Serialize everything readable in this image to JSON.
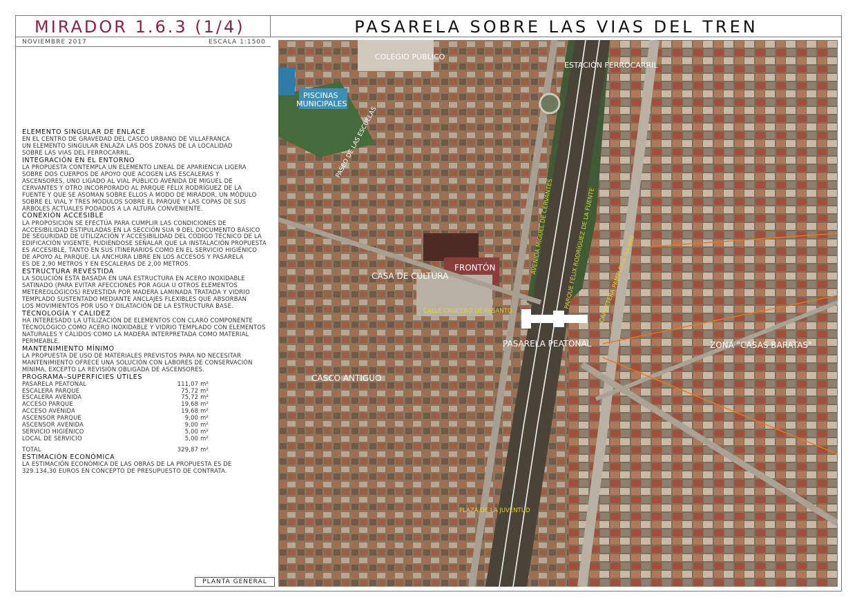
{
  "header": {
    "left_title": "MIRADOR 1.6.3 (1/4)",
    "right_title": "PASARELA SOBRE LAS VIAS DEL TREN",
    "date": "NOVIEMBRE 2017",
    "scale": "ESCALA 1:1500"
  },
  "colors": {
    "title_accent": "#8a2341",
    "map_labels": "#ffffff",
    "street_labels": "#e3d23a",
    "paths": "#e8781e"
  },
  "sections": [
    {
      "heading": "ELEMENTO SINGULAR DE ENLACE",
      "lines": [
        "EN EL CENTRO DE GRAVEDAD DEL CASCO URBANO DE VILLAFRANCA",
        "UN ELEMENTO SINGULAR ENLAZA LAS DOS ZONAS DE LA LOCALIDAD",
        "SOBRE LAS VIAS DEL FERROCARRIL."
      ]
    },
    {
      "heading": "INTEGRACIÓN EN EL ENTORNO",
      "lines": [
        "LA PROPUESTA CONTEMPLA UN ELEMENTO LINEAL DE APARIENCIA LIGERA",
        "SOBRE DOS CUERPOS DE APOYO QUE ACOGEN LAS ESCALERAS Y",
        "ASCENSORES, UNO LIGADO AL VIAL PÚBLICO AVENIDA DE MIGUEL DE",
        "CERVANTES Y OTRO INCORPORADO AL PARQUE FÉLIX RODRÍGUEZ DE LA",
        "FUENTE Y QUE SE ASOMAN SOBRE ELLOS A MODO DE MIRADOR, UN MÓDULO",
        "SOBRE EL VIAL Y TRES MÓDULOS SOBRE EL PARQUE Y LAS COPAS DE SUS",
        "ÁRBOLES ACTUALES PODADOS A LA ALTURA CONVENIENTE."
      ]
    },
    {
      "heading": "CONEXIÓN ACCESIBLE",
      "lines": [
        "LA PROPOSICIÓN SE EFECTÚA PARA CUMPLIR LAS CONDICIONES DE",
        "ACCESIBILIDAD ESTIPULADAS EN LA SECCIÓN SUA 9 DEL DOCUMENTO BÁSICO",
        "DE SEGURIDAD DE UTILIZACIÓN Y ACCESIBILIDAD DEL CÓDIGO TÉCNICO DE LA",
        "EDIFICACIÓN VIGENTE, PUDIÉNDOSE SEÑALAR QUE LA INSTALACIÓN PROPUESTA",
        "ES ACCESIBLE, TANTO EN SUS ITINERARIOS COMO EN EL SERVICIO HIGIÉNICO",
        "DE APOYO AL PARQUE. LA ANCHURA LIBRE EN LOS ACCESOS Y PASARELA",
        "ES DE 2,90 METROS Y EN ESCALERAS DE 2,00 METROS."
      ]
    },
    {
      "heading": "ESTRUCTURA REVESTIDA",
      "lines": [
        "LA SOLUCIÓN ESTA BASADA EN UNA ESTRUCTURA EN ACERO INOXIDABLE",
        "SATINADO (PARA EVITAR AFECCIONES POR AGUA U OTROS ELEMENTOS",
        "METEREOLÓGICOS) REVESTIDA POR MADERA LAMINADA TRATADA Y VIDRIO",
        "TEMPLADO SUSTENTADO MEDIANTE ANCLAJES FLEXIBLES QUE ABSORBAN",
        "LOS MOVIMIENTOS POR USO Y DILATACIÓN DE LA ESTRUCTURA BASE."
      ]
    },
    {
      "heading": "TECNOLOGÍA Y CALIDEZ",
      "lines": [
        "HA INTERESADO LA UTILIZACIÓN DE ELEMENTOS CON CLARO COMPONENTE",
        "TECNOLÓGICO COMO ACERO INOXIDABLE Y VIDRIO TEMPLADO CON ELEMENTOS",
        "NATURALES Y CÁLIDOS COMO LA MADERA INTERPRETADA COMO MATERIAL",
        "PERMEABLE."
      ]
    },
    {
      "heading": "MANTENIMIENTO MÍNIMO",
      "lines": [
        "LA PROPUESTA DE USO DE MATERIALES PREVISTOS PARA NO NECESITAR",
        "MANTENIMIENTO OFRECE UNA SOLUCIÓN CON LABORES DE CONSERVACIÓN",
        "MÍNIMA, EXCEPTO LA REVISIÓN OBLIGADA DE ASCENSORES."
      ]
    }
  ],
  "program": {
    "heading": "PROGRAMA–SUPERFICIES ÚTILES",
    "rows": [
      {
        "name": "PASARELA PEATONAL",
        "value": "111,07 m²"
      },
      {
        "name": "ESCALERA PARQUE",
        "value": "75,72 m²"
      },
      {
        "name": "ESCALERA AVENIDA",
        "value": "75,72 m²"
      },
      {
        "name": "ACCESO PARQUE",
        "value": "19,68 m²"
      },
      {
        "name": "ACCESO AVENIDA",
        "value": "19,68 m²"
      },
      {
        "name": "ASCENSOR PARQUE",
        "value": "9,00 m²"
      },
      {
        "name": "ASCENSOR AVENIDA",
        "value": "9,00 m²"
      },
      {
        "name": "SERVICIO HIGIÉNICO",
        "value": "5,00 m²"
      },
      {
        "name": "LOCAL DE SERVICIO",
        "value": "5,00 m²"
      }
    ],
    "total_label": "TOTAL",
    "total_value": "329,87 m²"
  },
  "estimate": {
    "heading": "ESTIMACIÓN ECONÓMICA",
    "lines": [
      "LA ESTIMACIÓN ECONÓMICA DE LAS OBRAS DE LA PROPUESTA ES DE",
      "329.134,30 EUROS EN CONCEPTO DE PRESUPUESTO DE CONTRATA."
    ]
  },
  "plan_label": "PLANTA GENERAL",
  "map": {
    "labels": {
      "colegio": "COLEGIO PÚBLICO",
      "piscinas_1": "PISCINAS",
      "piscinas_2": "MUNICIPALES",
      "estacion": "ESTACIÓN FERROCARRIL",
      "paseo": "PASEO DE LAS ESCUELAS",
      "fronton": "FRONTÓN",
      "casa_cultura": "CASA DE CULTURA",
      "pasarela": "PASARELA PEATONAL",
      "zona": "ZONA \"CASAS BARATAS\"",
      "casco": "CASCO ANTIGUO"
    },
    "street_labels": {
      "avenida": "AVENIDA MIGUEL DE CERVANTES",
      "vias": "VIAS FERROCARRIL LINEA CASTEJÓN-ALSASUA",
      "parque": "PARQUE FÉLIX RODRÍGUEZ DE LA FUENTE",
      "carretera": "CARRETERA PAMPLONA-NA-660",
      "calle": "CALLE CRUCERO DE PASANTO",
      "plaza": "PLAZA DE LA JUVENTUD"
    }
  }
}
